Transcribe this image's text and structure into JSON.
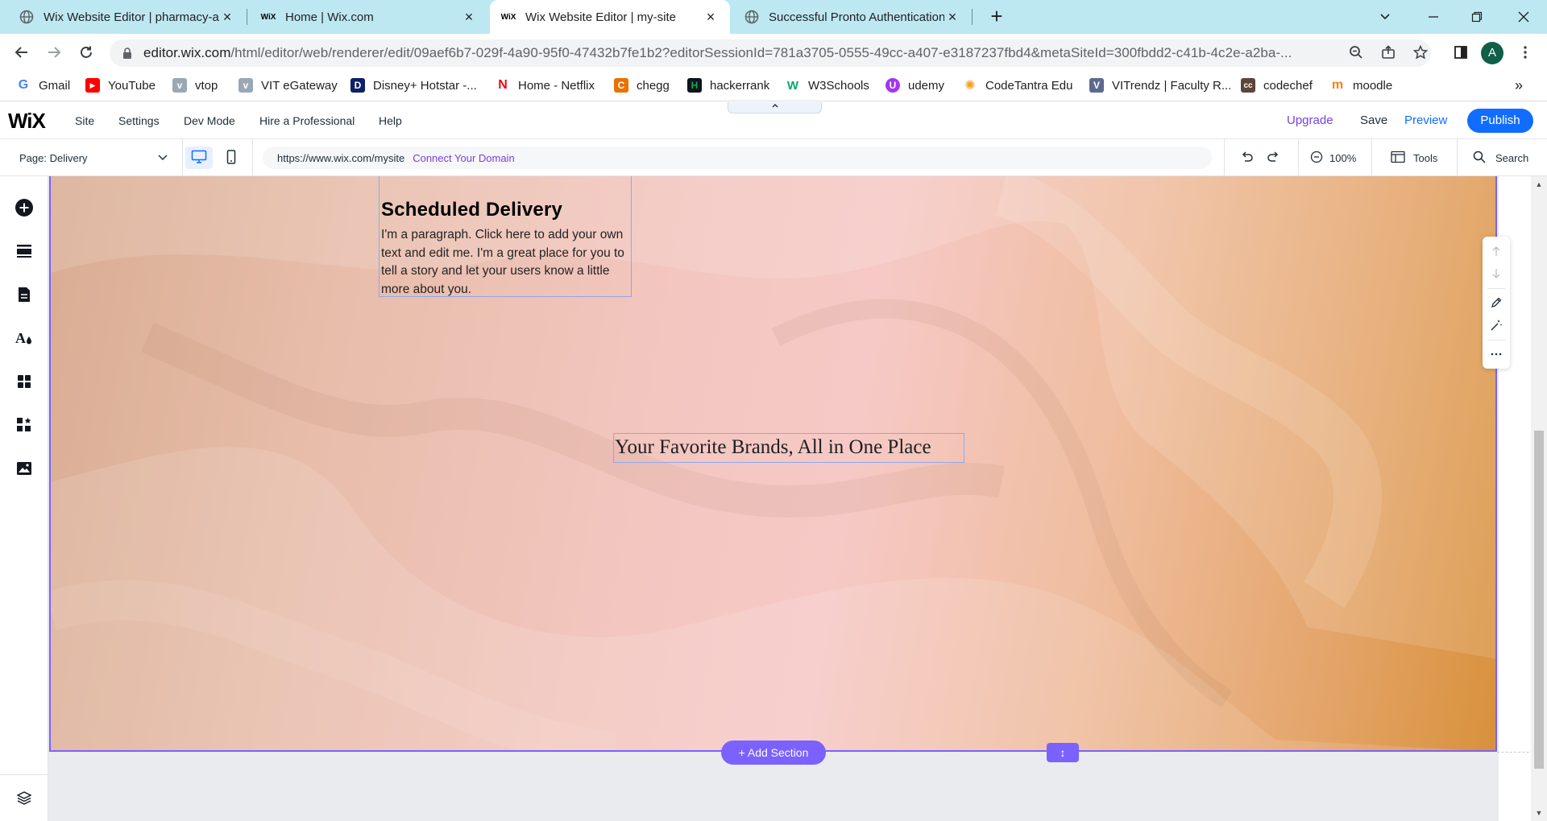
{
  "browser": {
    "tabs": [
      {
        "title": "Wix Website Editor | pharmacy-a",
        "close": "×",
        "favicon": "globe-icon"
      },
      {
        "title": "Home | Wix.com",
        "close": "×",
        "favicon": "wix-icon"
      },
      {
        "title": "Wix Website Editor | my-site",
        "close": "×",
        "favicon": "wix-icon",
        "active": true
      },
      {
        "title": "Successful Pronto Authentication",
        "close": "×",
        "favicon": "globe-icon"
      }
    ],
    "new_tab": "+",
    "url_main": "editor.wix.com",
    "url_rest": "/html/editor/web/renderer/edit/09aef6b7-029f-4a90-95f0-47432b7fe1b2?editorSessionId=781a3705-0555-49cc-a407-e3187237fbd4&metaSiteId=300fbdd2-c41b-4c2e-a2ba-...",
    "avatar": "A",
    "bookmarks": [
      {
        "label": "Gmail",
        "icon": "G",
        "color": "#ffffff"
      },
      {
        "label": "YouTube",
        "icon": "▶",
        "color": "#ff0000"
      },
      {
        "label": "vtop",
        "icon": "v",
        "color": "#9aa7b5"
      },
      {
        "label": "VIT eGateway",
        "icon": "v",
        "color": "#9aa7b5"
      },
      {
        "label": "Disney+ Hotstar -...",
        "icon": "D",
        "color": "#0c2166"
      },
      {
        "label": "Home - Netflix",
        "icon": "N",
        "color": "#e50914"
      },
      {
        "label": "chegg",
        "icon": "C",
        "color": "#eb7100"
      },
      {
        "label": "hackerrank",
        "icon": "H",
        "color": "#1ba94c"
      },
      {
        "label": "W3Schools",
        "icon": "W",
        "color": "#04aa6d"
      },
      {
        "label": "udemy",
        "icon": "U",
        "color": "#a435f0"
      },
      {
        "label": "CodeTantra Edu",
        "icon": "✺",
        "color": "#f4a11d"
      },
      {
        "label": "VITrendz | Faculty R...",
        "icon": "V",
        "color": "#5b6b8c"
      },
      {
        "label": "codechef",
        "icon": "cc",
        "color": "#5b4638"
      },
      {
        "label": "moodle",
        "icon": "m",
        "color": "#f98012"
      }
    ],
    "more": "»"
  },
  "wix": {
    "logo": "WiX",
    "menu": [
      "Site",
      "Settings",
      "Dev Mode",
      "Hire a Professional",
      "Help"
    ],
    "upgrade": "Upgrade",
    "save": "Save",
    "preview": "Preview",
    "publish": "Publish",
    "page_label": "Page: Delivery",
    "site_url": "https://www.wix.com/mysite",
    "connect_domain": "Connect Your Domain",
    "zoom": "100%",
    "tools": "Tools",
    "search": "Search",
    "accent_color": "#7b61ff",
    "publish_color": "#116dff"
  },
  "canvas": {
    "heading": "Scheduled Delivery",
    "paragraph": "I'm a paragraph. Click here to add your own text and edit me. I'm a great place for you to tell a story and let your users know a little more about you.",
    "tagline": "Your Favorite Brands, All in One Place",
    "add_section": "+ Add Section",
    "stretch_icon": "↕"
  }
}
